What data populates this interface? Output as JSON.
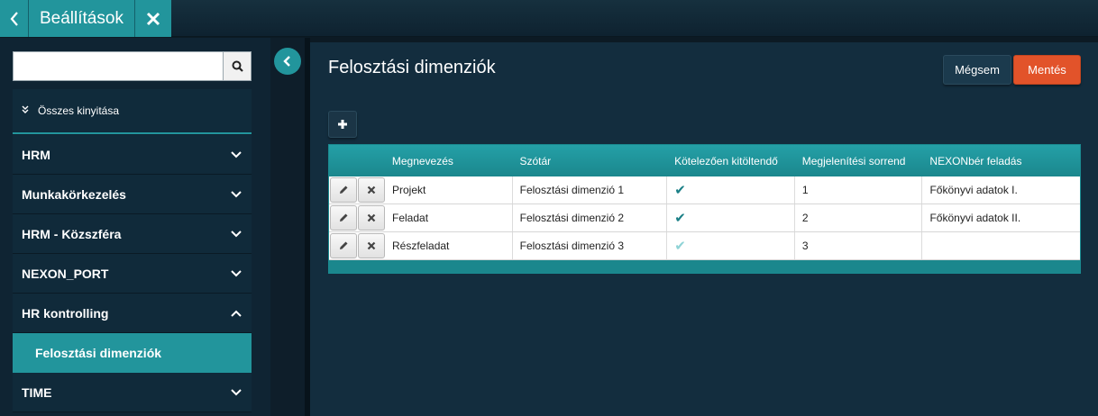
{
  "topbar": {
    "title": "Beállítások"
  },
  "sidebar": {
    "search_placeholder": "",
    "expand_all_label": "Összes kinyitása",
    "items": [
      {
        "label": "HRM",
        "state": "collapsed"
      },
      {
        "label": "Munkakörkezelés",
        "state": "collapsed"
      },
      {
        "label": "HRM - Közszféra",
        "state": "collapsed"
      },
      {
        "label": "NEXON_PORT",
        "state": "collapsed"
      },
      {
        "label": "HR kontrolling",
        "state": "expanded"
      },
      {
        "label": "TIME",
        "state": "collapsed"
      }
    ],
    "active_subitem": "Felosztási dimenziók"
  },
  "main": {
    "title": "Felosztási dimenziók",
    "cancel_label": "Mégsem",
    "save_label": "Mentés",
    "table": {
      "headers": [
        "Megnevezés",
        "Szótár",
        "Kötelezően kitöltendő",
        "Megjelenítési sorrend",
        "NEXONbér feladás"
      ],
      "rows": [
        {
          "name": "Projekt",
          "dictionary": "Felosztási dimenzió 1",
          "required": true,
          "order": "1",
          "nexon": "Főkönyvi adatok I."
        },
        {
          "name": "Feladat",
          "dictionary": "Felosztási dimenzió 2",
          "required": true,
          "order": "2",
          "nexon": "Főkönyvi adatok II."
        },
        {
          "name": "Részfeladat",
          "dictionary": "Felosztási dimenzió 3",
          "required": false,
          "order": "3",
          "nexon": ""
        }
      ]
    }
  },
  "colors": {
    "accent": "#22959c",
    "save": "#e2532a",
    "background": "#132d3e"
  }
}
